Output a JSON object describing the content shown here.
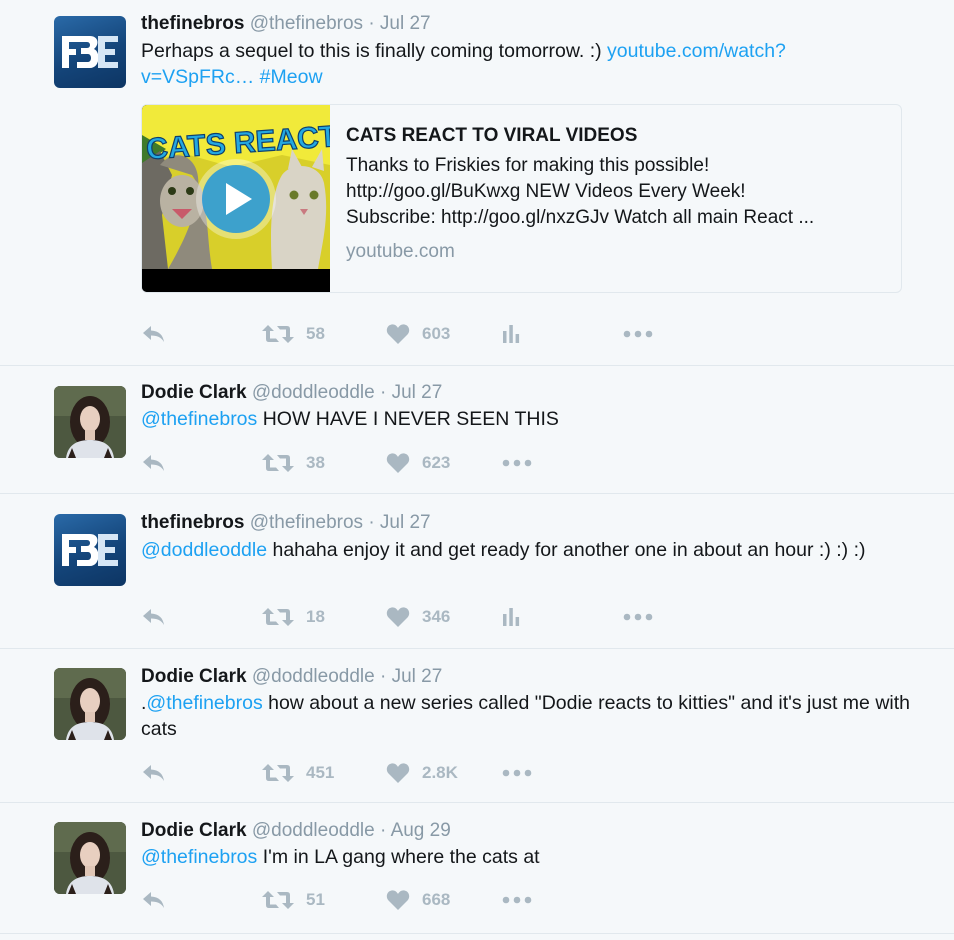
{
  "colors": {
    "link": "#1da1f2",
    "muted": "#8899a6",
    "icon": "#aab8c2",
    "background": "#f5f8fa"
  },
  "tweets": [
    {
      "name": "thefinebros",
      "handle": "@thefinebros",
      "separator": "·",
      "time": "Jul 27",
      "avatar": "fbe-logo",
      "text": "Perhaps a sequel to this is finally coming tomorrow. :) ",
      "link1": "youtube.com/watch?v=VSpFRc…",
      "link2": "#Meow",
      "card": {
        "title": "CATS REACT TO VIRAL VIDEOS",
        "description": "Thanks to Friskies for making this possible!\nhttp://goo.gl/BuKwxg NEW Videos Every Week!\nSubscribe: http://goo.gl/nxzGJv Watch all main React ...",
        "domain": "youtube.com",
        "thumb_text": "CATS REACT"
      },
      "retweets": "58",
      "likes": "603",
      "analytics_icon": "analytics-icon"
    },
    {
      "name": "Dodie Clark",
      "handle": "@doddleoddle",
      "separator": "·",
      "time": "Jul 27",
      "avatar": "dodie-photo",
      "mention": "@thefinebros",
      "text": " HOW HAVE I NEVER SEEN THIS",
      "retweets": "38",
      "likes": "623"
    },
    {
      "name": "thefinebros",
      "handle": "@thefinebros",
      "separator": "·",
      "time": "Jul 27",
      "avatar": "fbe-logo",
      "mention": "@doddleoddle",
      "text": " hahaha enjoy it and get ready for another one in about an hour :) :) :)",
      "retweets": "18",
      "likes": "346",
      "analytics_icon": "analytics-icon"
    },
    {
      "name": "Dodie Clark",
      "handle": "@doddleoddle",
      "separator": "·",
      "time": "Jul 27",
      "avatar": "dodie-photo",
      "prefix": ".",
      "mention": "@thefinebros",
      "text": " how about a new series called \"Dodie reacts to kitties\" and it's just me with cats",
      "retweets": "451",
      "likes": "2.8K"
    },
    {
      "name": "Dodie Clark",
      "handle": "@doddleoddle",
      "separator": "·",
      "time": "Aug 29",
      "avatar": "dodie-photo",
      "mention": "@thefinebros",
      "text": " I'm in LA gang where the cats at",
      "retweets": "51",
      "likes": "668"
    }
  ]
}
